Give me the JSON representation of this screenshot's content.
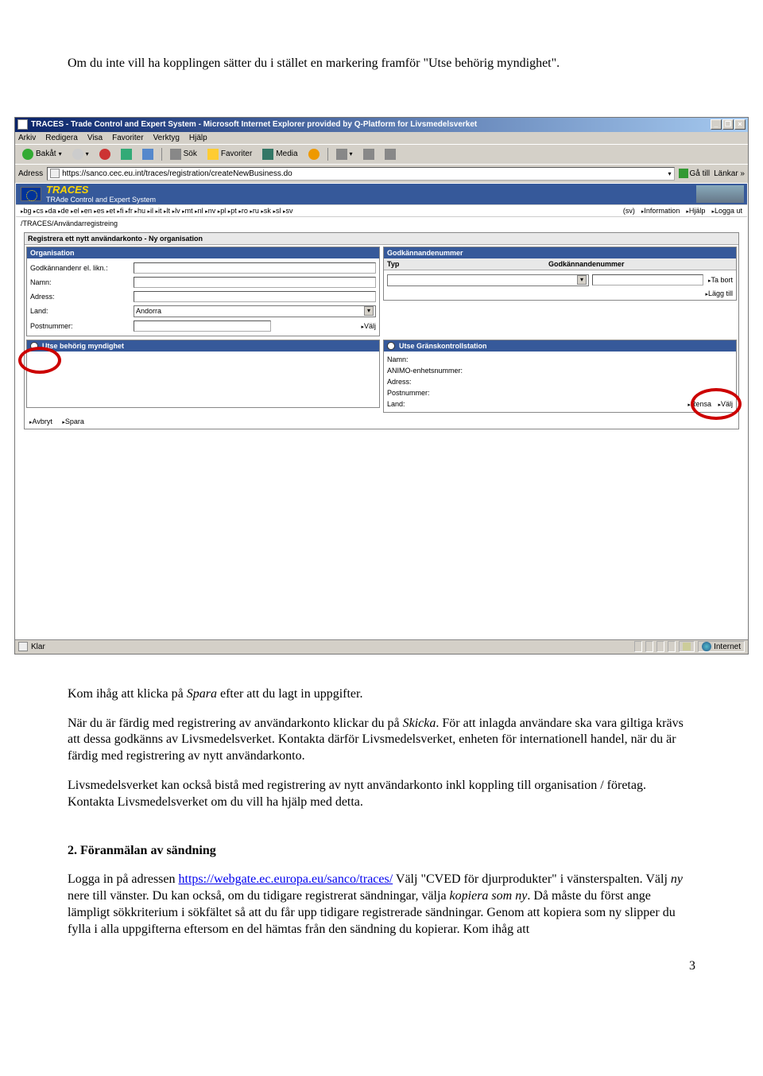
{
  "doc": {
    "intro": "Om du inte vill ha kopplingen sätter du i stället en markering framför \"Utse behörig myndighet\".",
    "kom_ihag_1": "Kom ihåg att klicka på ",
    "spara_it": "Spara",
    "kom_ihag_2": " efter att du lagt in uppgifter.",
    "nar_du_1": "När du är färdig med registrering av användarkonto klickar du på ",
    "skicka_it": "Skicka",
    "nar_du_2": ". För att inlagda användare ska vara giltiga krävs att dessa godkänns av Livsmedelsverket. Kontakta därför Livsmedelsverket, enheten för internationell handel, när du är färdig med registrering av nytt användarkonto.",
    "livs": "Livsmedelsverket kan också bistå med registrering av nytt användarkonto inkl koppling till organisation / företag. Kontakta Livsmedelsverket om du vill ha hjälp med detta.",
    "sect2_heading": "2. Föranmälan av sändning",
    "sect2_1a": "Logga in på adressen ",
    "sect2_url": "https://webgate.ec.europa.eu/sanco/traces/",
    "sect2_1b": " Välj \"CVED för djurprodukter\" i vänsterspalten. Välj ",
    "ny_it": "ny",
    "sect2_1c": " nere till vänster. Du kan också, om du tidigare registrerat sändningar, välja ",
    "kopiera_it": "kopiera som ny",
    "sect2_1d": ". Då måste du först ange lämpligt sökkriterium i sökfältet så att du får upp tidigare registrerade sändningar. Genom att kopiera som ny slipper du fylla i alla uppgifterna eftersom en del hämtas från den sändning du kopierar. Kom ihåg att",
    "page_num": "3"
  },
  "window": {
    "title": "TRACES - Trade Control and Expert System - Microsoft Internet Explorer provided by Q-Platform for Livsmedelsverket"
  },
  "menubar": {
    "arkiv": "Arkiv",
    "redigera": "Redigera",
    "visa": "Visa",
    "favoriter": "Favoriter",
    "verktyg": "Verktyg",
    "hjalp": "Hjälp"
  },
  "toolbar": {
    "bakat": "Bakåt",
    "sok": "Sök",
    "favoriter": "Favoriter",
    "media": "Media"
  },
  "addr": {
    "label": "Adress",
    "url": "https://sanco.cec.eu.int/traces/registration/createNewBusiness.do",
    "go": "Gå till",
    "lankar": "Länkar"
  },
  "traces": {
    "logo": "TRACES",
    "sub": "TRAde Control and Expert System"
  },
  "lang": {
    "items": [
      "bg",
      "cs",
      "da",
      "de",
      "el",
      "en",
      "es",
      "et",
      "fi",
      "fr",
      "hu",
      "il",
      "it",
      "lt",
      "lv",
      "mt",
      "nl",
      "nv",
      "pl",
      "pt",
      "ro",
      "ru",
      "sk",
      "sl",
      "sv"
    ],
    "current": "(sv)",
    "info": "Information",
    "hjalp": "Hjälp",
    "logga_ut": "Logga ut"
  },
  "crumb": "/TRACES/Användarregistreing",
  "reg": {
    "title": "Registrera ett nytt användarkonto - Ny organisation",
    "organisation": "Organisation",
    "godkannandenr": "Godkännandenr el. likn.:",
    "namn": "Namn:",
    "adress": "Adress:",
    "land": "Land:",
    "land_val": "Andorra",
    "postnummer": "Postnummer:",
    "valj": "Välj",
    "godk_head": "Godkännandenummer",
    "typ": "Typ",
    "godk_col": "Godkännandenummer",
    "ta_bort": "Ta bort",
    "lagg_till": "Lägg till",
    "myndighet": "Utse behörig myndighet",
    "grans": "Utse Gränskontrollstation",
    "animo": "ANIMO-enhetsnummer:",
    "rensa": "Rensa",
    "avbryt": "Avbryt",
    "spara": "Spara"
  },
  "status": {
    "klar": "Klar",
    "internet": "Internet"
  }
}
